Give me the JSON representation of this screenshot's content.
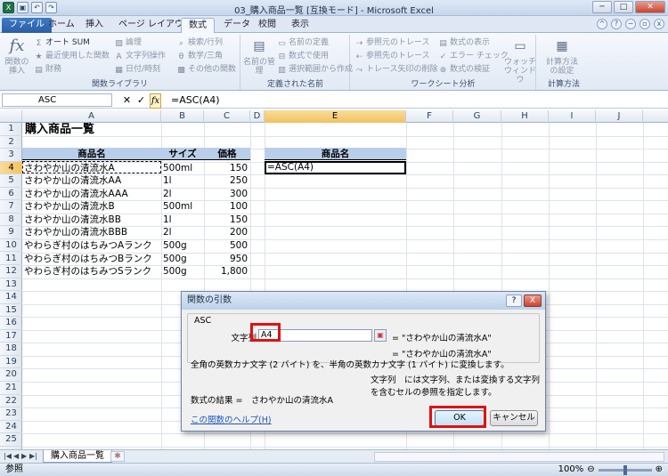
{
  "window": {
    "title": "03_購入商品一覧 [互換モード] - Microsoft Excel"
  },
  "tabs": [
    "ファイル",
    "ホーム",
    "挿入",
    "ページ レイアウト",
    "数式",
    "データ",
    "校閲",
    "表示"
  ],
  "ribbon": {
    "insert_function": "関数の挿入",
    "autosum": "オート SUM",
    "recent": "最近使用した関数",
    "financial": "財務",
    "logical": "論理",
    "text": "文字列操作",
    "datetime": "日付/時刻",
    "lookup": "検索/行列",
    "math": "数学/三角",
    "more": "その他の関数",
    "group1": "関数ライブラリ",
    "name_manager": "名前の管理",
    "define_name": "名前の定義",
    "use_in_formula": "数式で使用",
    "create_from_sel": "選択範囲から作成",
    "group2": "定義された名前",
    "trace_prec": "参照元のトレース",
    "trace_dep": "参照先のトレース",
    "remove_arrows": "トレース矢印の削除",
    "show_formulas": "数式の表示",
    "error_check": "エラー チェック",
    "evaluate": "数式の検証",
    "watch": "ウォッチ ウィンドウ",
    "group3": "ワークシート分析",
    "calc_options": "計算方法の設定",
    "group4": "計算方法"
  },
  "formula_bar": {
    "name_box": "ASC",
    "formula": "=ASC(A4)"
  },
  "columns": [
    "A",
    "B",
    "C",
    "D",
    "E",
    "F",
    "G",
    "H",
    "I",
    "J"
  ],
  "rows": [
    "1",
    "2",
    "3",
    "4",
    "5",
    "6",
    "7",
    "8",
    "9",
    "10",
    "11",
    "12",
    "13",
    "14",
    "15",
    "16",
    "17",
    "18",
    "19",
    "20",
    "21",
    "22",
    "23",
    "24",
    "25"
  ],
  "sheet": {
    "title": "購入商品一覧",
    "headers": {
      "name": "商品名",
      "size": "サイズ",
      "price": "価格",
      "e_header": "商品名"
    },
    "items": [
      {
        "name": "さわやか山の清流水A",
        "size": "500ml",
        "price": "150"
      },
      {
        "name": "さわやか山の清流水AA",
        "size": "1l",
        "price": "250"
      },
      {
        "name": "さわやか山の清流水AAA",
        "size": "2l",
        "price": "300"
      },
      {
        "name": "さわやか山の清流水B",
        "size": "500ml",
        "price": "100"
      },
      {
        "name": "さわやか山の清流水BB",
        "size": "1l",
        "price": "150"
      },
      {
        "name": "さわやか山の清流水BBB",
        "size": "2l",
        "price": "200"
      },
      {
        "name": "やわらぎ村のはちみつAランク",
        "size": "500g",
        "price": "500"
      },
      {
        "name": "やわらぎ村のはちみつBランク",
        "size": "500g",
        "price": "950"
      },
      {
        "name": "やわらぎ村のはちみつSランク",
        "size": "500g",
        "price": "1,800"
      }
    ],
    "e4": "=ASC(A4)"
  },
  "sheet_tab": "購入商品一覧",
  "status": {
    "ready": "参照",
    "zoom": "100%"
  },
  "dialog": {
    "title": "関数の引数",
    "fn_name": "ASC",
    "arg_label": "文字列",
    "arg_value": "A4",
    "arg_eval": "= \"さわやか山の清流水A\"",
    "result_eval": "= \"さわやか山の清流水A\"",
    "description": "全角の英数カナ文字 (2 バイト) を、半角の英数カナ文字 (1 バイト) に変換します。",
    "arg_description": "文字列　には文字列、または変換する文字列を含むセルの参照を指定します。",
    "formula_result": "数式の結果 =　さわやか山の清流水A",
    "help_link": "この関数のヘルプ(H)",
    "ok": "OK",
    "cancel": "キャンセル",
    "help_btn": "?",
    "close_btn": "X"
  }
}
